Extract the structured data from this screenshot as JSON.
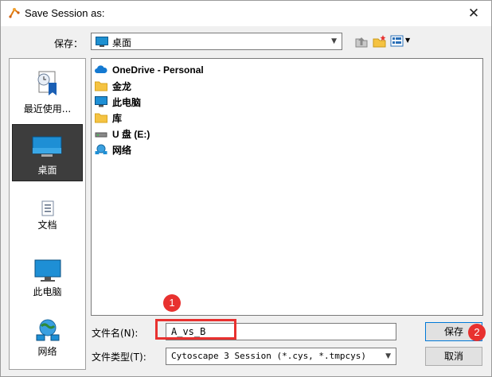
{
  "window": {
    "title": "Save Session as:",
    "close_label": "✕"
  },
  "save_in": {
    "label": "保存：",
    "value": "桌面"
  },
  "places": [
    {
      "label": "最近使用...",
      "icon": "recent-icon"
    },
    {
      "label": "桌面",
      "icon": "desktop-icon",
      "selected": true
    },
    {
      "label": "文档",
      "icon": "documents-icon"
    },
    {
      "label": "此电脑",
      "icon": "computer-icon"
    },
    {
      "label": "网络",
      "icon": "network-icon"
    }
  ],
  "files": [
    {
      "name": "OneDrive - Personal",
      "icon": "cloud-icon"
    },
    {
      "name": "金龙",
      "icon": "folder-icon"
    },
    {
      "name": "此电脑",
      "icon": "computer-icon"
    },
    {
      "name": "库",
      "icon": "folder-icon"
    },
    {
      "name": "U 盘 (E:)",
      "icon": "drive-icon"
    },
    {
      "name": "网络",
      "icon": "network-icon"
    }
  ],
  "filename": {
    "label": "文件名(N):",
    "value": "A_vs_B"
  },
  "filetype": {
    "label": "文件类型(T):",
    "value": "Cytoscape 3 Session (*.cys, *.tmpcys)"
  },
  "buttons": {
    "save": "保存",
    "cancel": "取消"
  },
  "annotations": {
    "badge1": "1",
    "badge2": "2"
  },
  "colors": {
    "accent": "#0078d7",
    "annotation_red": "#e8312f"
  }
}
